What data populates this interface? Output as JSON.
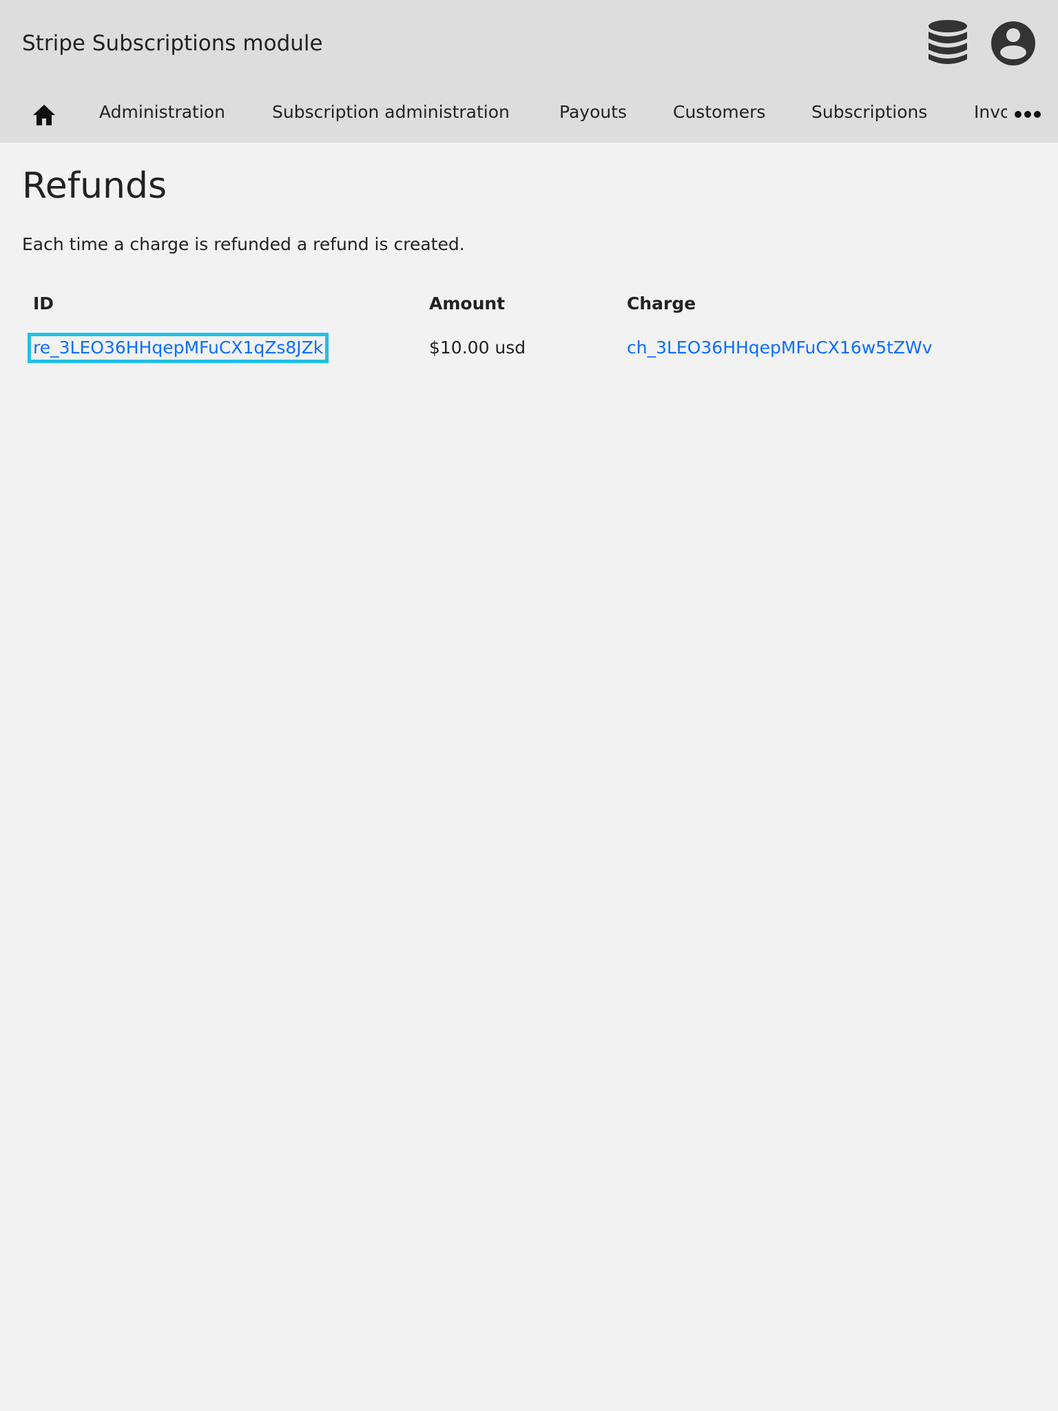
{
  "header": {
    "title": "Stripe Subscriptions module",
    "database_icon": "database-icon",
    "user_icon": "user-circle-icon"
  },
  "nav": {
    "home_icon": "home-icon",
    "items": [
      {
        "label": "Administration"
      },
      {
        "label": "Subscription administration"
      },
      {
        "label": "Payouts"
      },
      {
        "label": "Customers"
      },
      {
        "label": "Subscriptions"
      },
      {
        "label": "Invoices"
      }
    ],
    "more_icon": "ellipsis-icon"
  },
  "main": {
    "title": "Refunds",
    "description": "Each time a charge is refunded a refund is created.",
    "table": {
      "columns": [
        "ID",
        "Amount",
        "Charge"
      ],
      "rows": [
        {
          "id": "re_3LEO36HHqepMFuCX1qZs8JZk",
          "amount": "$10.00 usd",
          "charge": "ch_3LEO36HHqepMFuCX16w5tZWv"
        }
      ]
    }
  },
  "colors": {
    "header_bg": "#dddddd",
    "page_bg": "#f2f2f2",
    "link": "#0d6efd",
    "focus_outline": "#1ec0e8",
    "icon": "#333333"
  }
}
